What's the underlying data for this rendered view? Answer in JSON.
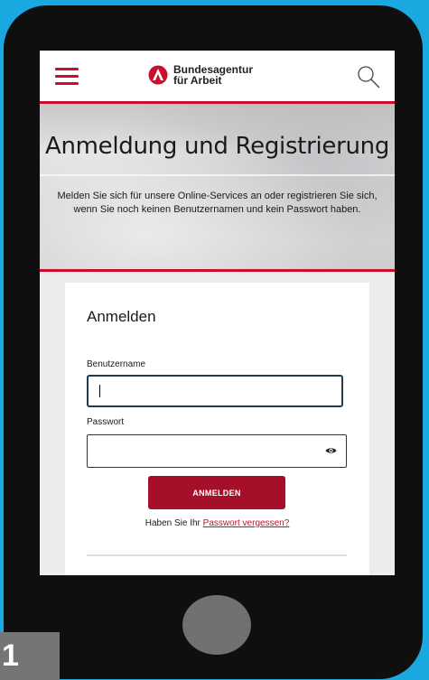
{
  "header": {
    "brand_line1": "Bundesagentur",
    "brand_line2": "für Arbeit",
    "brand_color": "#c8102e",
    "icons": [
      "menu-icon",
      "ba-logo",
      "search-icon"
    ]
  },
  "hero": {
    "title": "Anmeldung und Registrierung",
    "description": "Melden Sie sich für unsere Online-Services an oder registrieren Sie sich, wenn Sie noch keinen Benutzernamen und kein Passwort haben."
  },
  "login": {
    "title": "Anmelden",
    "username_label": "Benutzername",
    "username_value": "",
    "password_label": "Passwort",
    "password_value": "",
    "submit_label": "ANMELDEN",
    "forgot_prefix": "Haben Sie Ihr ",
    "forgot_link": "Passwort vergessen?",
    "button_color": "#a50f29"
  },
  "badge": {
    "label": "1"
  }
}
